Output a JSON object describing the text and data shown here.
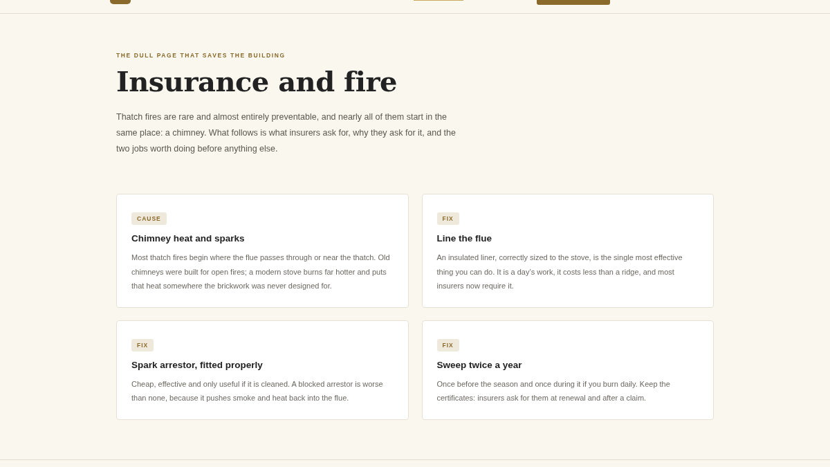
{
  "eyebrow": "THE DULL PAGE THAT SAVES THE BUILDING",
  "title": "Insurance and fire",
  "intro": "Thatch fires are rare and almost entirely preventable, and nearly all of them start in the same place: a chimney. What follows is what insurers ask for, why they ask for it, and the two jobs worth doing before anything else.",
  "cards": [
    {
      "tag": "CAUSE",
      "heading": "Chimney heat and sparks",
      "body": "Most thatch fires begin where the flue passes through or near the thatch. Old chimneys were built for open fires; a modern stove burns far hotter and puts that heat somewhere the brickwork was never designed for."
    },
    {
      "tag": "FIX",
      "heading": "Line the flue",
      "body": "An insulated liner, correctly sized to the stove, is the single most effective thing you can do. It is a day’s work, it costs less than a ridge, and most insurers now require it."
    },
    {
      "tag": "FIX",
      "heading": "Spark arrestor, fitted properly",
      "body": "Cheap, effective and only useful if it is cleaned. A blocked arrestor is worse than none, because it pushes smoke and heat back into the flue."
    },
    {
      "tag": "FIX",
      "heading": "Sweep twice a year",
      "body": "Once before the season and once during it if you burn daily. Keep the certificates: insurers ask for them at renewal and after a claim."
    }
  ]
}
